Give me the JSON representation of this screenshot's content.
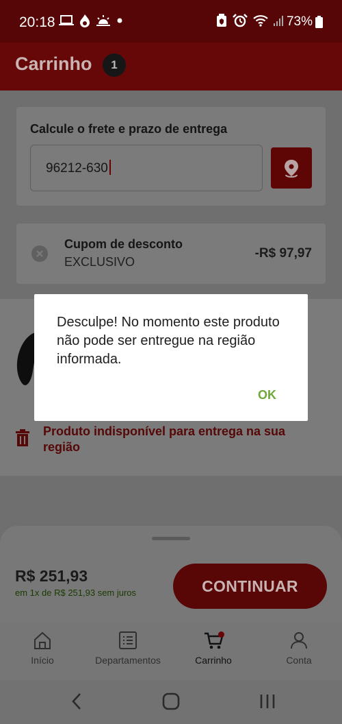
{
  "status_bar": {
    "time": "20:18",
    "battery": "73%",
    "icons": [
      "laptop-icon",
      "flame-icon",
      "sunrise-icon",
      "dot-icon",
      "security-icon",
      "alarm-icon",
      "wifi-icon",
      "signal-icon",
      "battery-icon"
    ]
  },
  "header": {
    "title": "Carrinho",
    "badge_count": "1"
  },
  "freight": {
    "title": "Calcule o frete e prazo de entrega",
    "cep_value": "96212-630",
    "locate_icon": "location-pin-icon"
  },
  "coupon": {
    "title": "Cupom de desconto",
    "code": "EXCLUSIVO",
    "amount": "-R$ 97,97"
  },
  "product": {
    "unavailable_message": "Produto indisponível para entrega na sua região"
  },
  "dialog": {
    "message": "Desculpe! No momento este produto não pode ser entregue na região informada.",
    "ok_label": "OK"
  },
  "summary": {
    "total": "R$ 251,93",
    "installments": "em 1x de R$ 251,93 sem juros",
    "continue_label": "CONTINUAR"
  },
  "bottom_nav": {
    "items": [
      {
        "label": "Início",
        "icon": "home-icon"
      },
      {
        "label": "Departamentos",
        "icon": "list-icon"
      },
      {
        "label": "Carrinho",
        "icon": "cart-icon"
      },
      {
        "label": "Conta",
        "icon": "user-icon"
      }
    ],
    "active": "Carrinho"
  },
  "colors": {
    "brand_red": "#b30f0f",
    "ok_green": "#6ea83a",
    "overlay": "rgba(0,0,0,0.52)"
  }
}
